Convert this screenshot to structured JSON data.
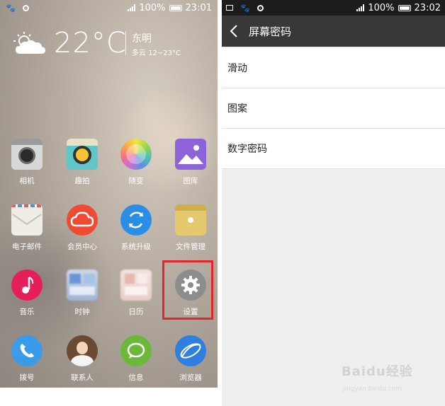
{
  "home": {
    "status": {
      "battery": "100%",
      "time": "23:01"
    },
    "weather": {
      "temperature": "22°C",
      "city": "东明",
      "description": "多云 12~23°C"
    },
    "apps": [
      {
        "label": "相机"
      },
      {
        "label": "趣拍"
      },
      {
        "label": "随变"
      },
      {
        "label": "图库"
      },
      {
        "label": "电子邮件"
      },
      {
        "label": "会员中心"
      },
      {
        "label": "系统升级"
      },
      {
        "label": "文件管理"
      },
      {
        "label": "音乐"
      },
      {
        "label": "时钟"
      },
      {
        "label": "日历"
      },
      {
        "label": "设置"
      },
      {
        "label": "拨号"
      },
      {
        "label": "联系人"
      },
      {
        "label": "信息"
      },
      {
        "label": "浏览器"
      }
    ]
  },
  "settings": {
    "status": {
      "battery": "100%",
      "time": "23:02"
    },
    "title": "屏幕密码",
    "options": [
      {
        "label": "滑动"
      },
      {
        "label": "图案"
      },
      {
        "label": "数字密码"
      }
    ]
  },
  "watermark": {
    "brand": "Baidu经验",
    "url": "jingyan.baidu.com"
  },
  "colors": {
    "highlight": "#e3262b",
    "topbar": "#383838",
    "statusbar": "#1c1c1c"
  }
}
